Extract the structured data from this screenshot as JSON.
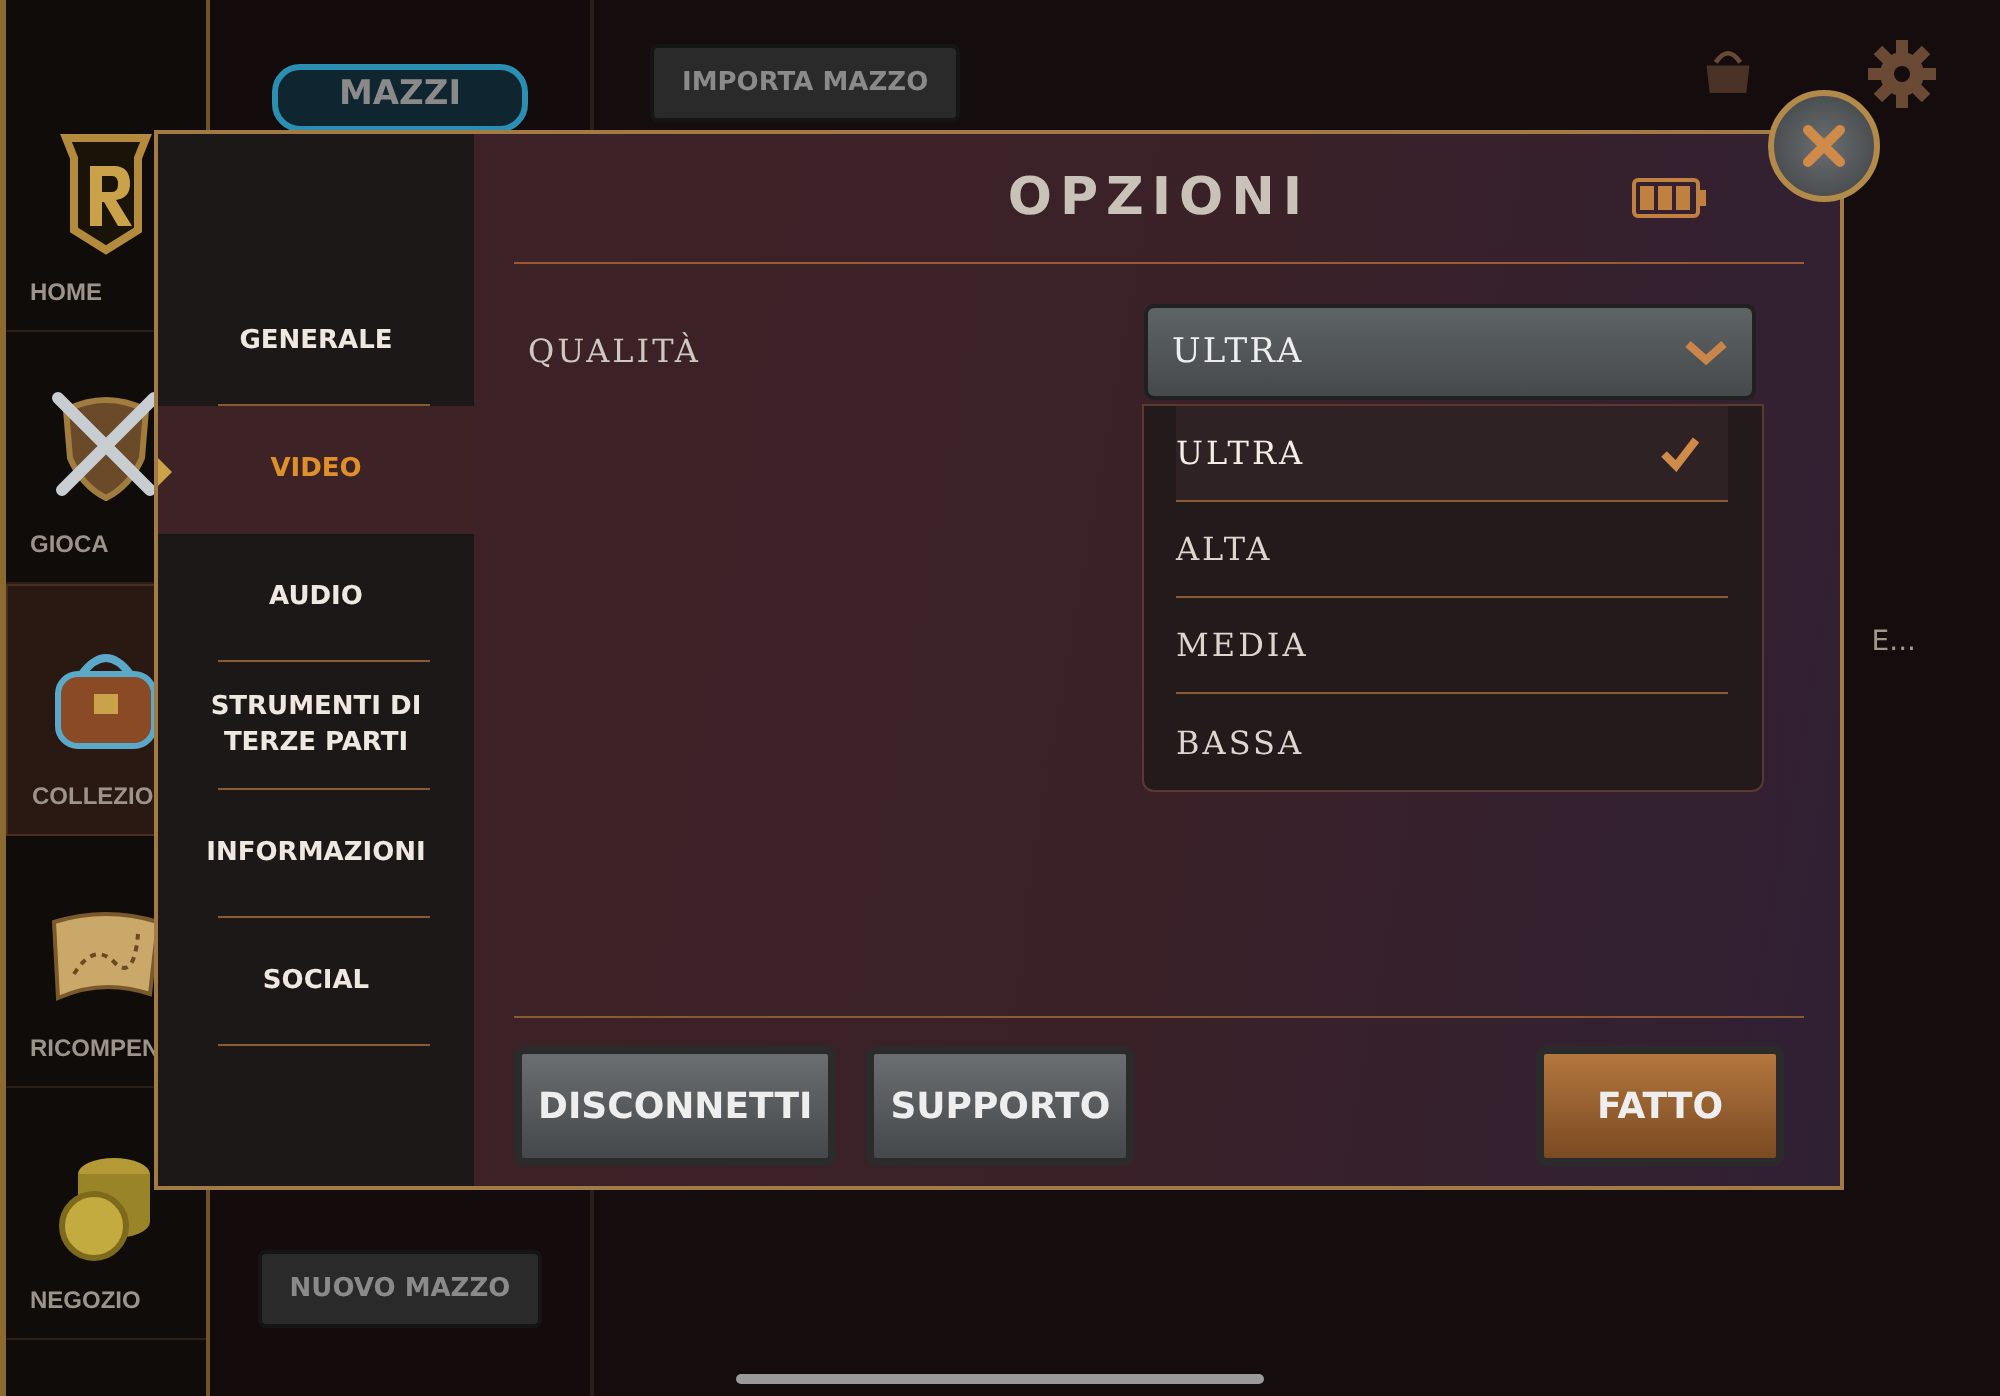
{
  "nav": [
    {
      "label": "HOME",
      "kind": "logo",
      "selected": false
    },
    {
      "label": "GIOCA",
      "kind": "swords",
      "selected": false
    },
    {
      "label": "COLLEZIO",
      "kind": "bag",
      "selected": true
    },
    {
      "label": "RICOMPEN",
      "kind": "map",
      "selected": false
    },
    {
      "label": "NEGOZIO",
      "kind": "coins",
      "selected": false
    }
  ],
  "decks": {
    "tab": "MAZZI",
    "new_button": "NUOVO MAZZO"
  },
  "library": {
    "import_button": "IMPORTA MAZZO",
    "card_caption": "E..."
  },
  "dialog": {
    "title": "OPZIONI",
    "categories": [
      {
        "label": "GENERALE",
        "selected": false
      },
      {
        "label": "VIDEO",
        "selected": true
      },
      {
        "label": "AUDIO",
        "selected": false
      },
      {
        "label": "STRUMENTI DI TERZE PARTI",
        "selected": false
      },
      {
        "label": "INFORMAZIONI",
        "selected": false
      },
      {
        "label": "SOCIAL",
        "selected": false
      }
    ],
    "setting": {
      "label": "QUALITÀ",
      "value": "ULTRA",
      "expanded": true,
      "options": [
        {
          "label": "ULTRA",
          "selected": true
        },
        {
          "label": "ALTA",
          "selected": false
        },
        {
          "label": "MEDIA",
          "selected": false
        },
        {
          "label": "BASSA",
          "selected": false
        }
      ]
    },
    "buttons": [
      {
        "label": "DISCONNETTI",
        "kind": "secondary"
      },
      {
        "label": "SUPPORTO",
        "kind": "secondary"
      },
      {
        "label": "FATTO",
        "kind": "primary"
      }
    ]
  }
}
